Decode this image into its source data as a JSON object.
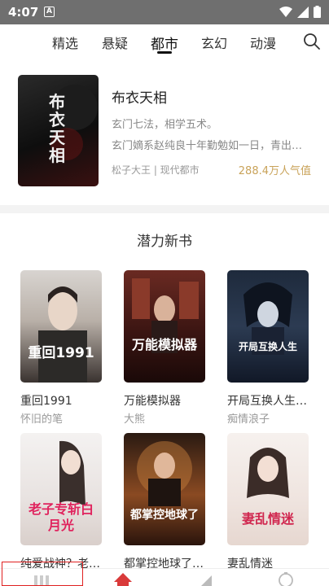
{
  "status_bar": {
    "time": "4:07",
    "notification_letter": "A"
  },
  "tabs": [
    {
      "label": "精选"
    },
    {
      "label": "悬疑"
    },
    {
      "label": "都市"
    },
    {
      "label": "玄幻"
    },
    {
      "label": "动漫"
    }
  ],
  "active_tab": "都市",
  "featured": {
    "title": "布衣天相",
    "line1": "玄门七法，相学五术。",
    "line2": "玄门嫡系赵纯良十年勤勉如一日，青出…",
    "meta": "松子大王 | 现代都市",
    "popularity": "288.4万人气值",
    "cover_text": "布衣天相"
  },
  "section_title": "潜力新书",
  "books": [
    {
      "name": "重回1991",
      "author": "怀旧的笔",
      "cover_text": "重回1991"
    },
    {
      "name": "万能模拟器",
      "author": "大熊",
      "cover_text": "万能模拟器"
    },
    {
      "name": "开局互换人生…",
      "author": "痴情浪子",
      "cover_text": "开局互换人生"
    },
    {
      "name": "纯爱战神？老…",
      "author": "",
      "cover_text": "老子专斩白月光"
    },
    {
      "name": "都掌控地球了…",
      "author": "",
      "cover_text": "都掌控地球了"
    },
    {
      "name": "妻乱情迷",
      "author": "",
      "cover_text": "妻乱情迷"
    }
  ],
  "colors": {
    "popularity": "#c9a35a",
    "highlight_box": "#e02020"
  }
}
